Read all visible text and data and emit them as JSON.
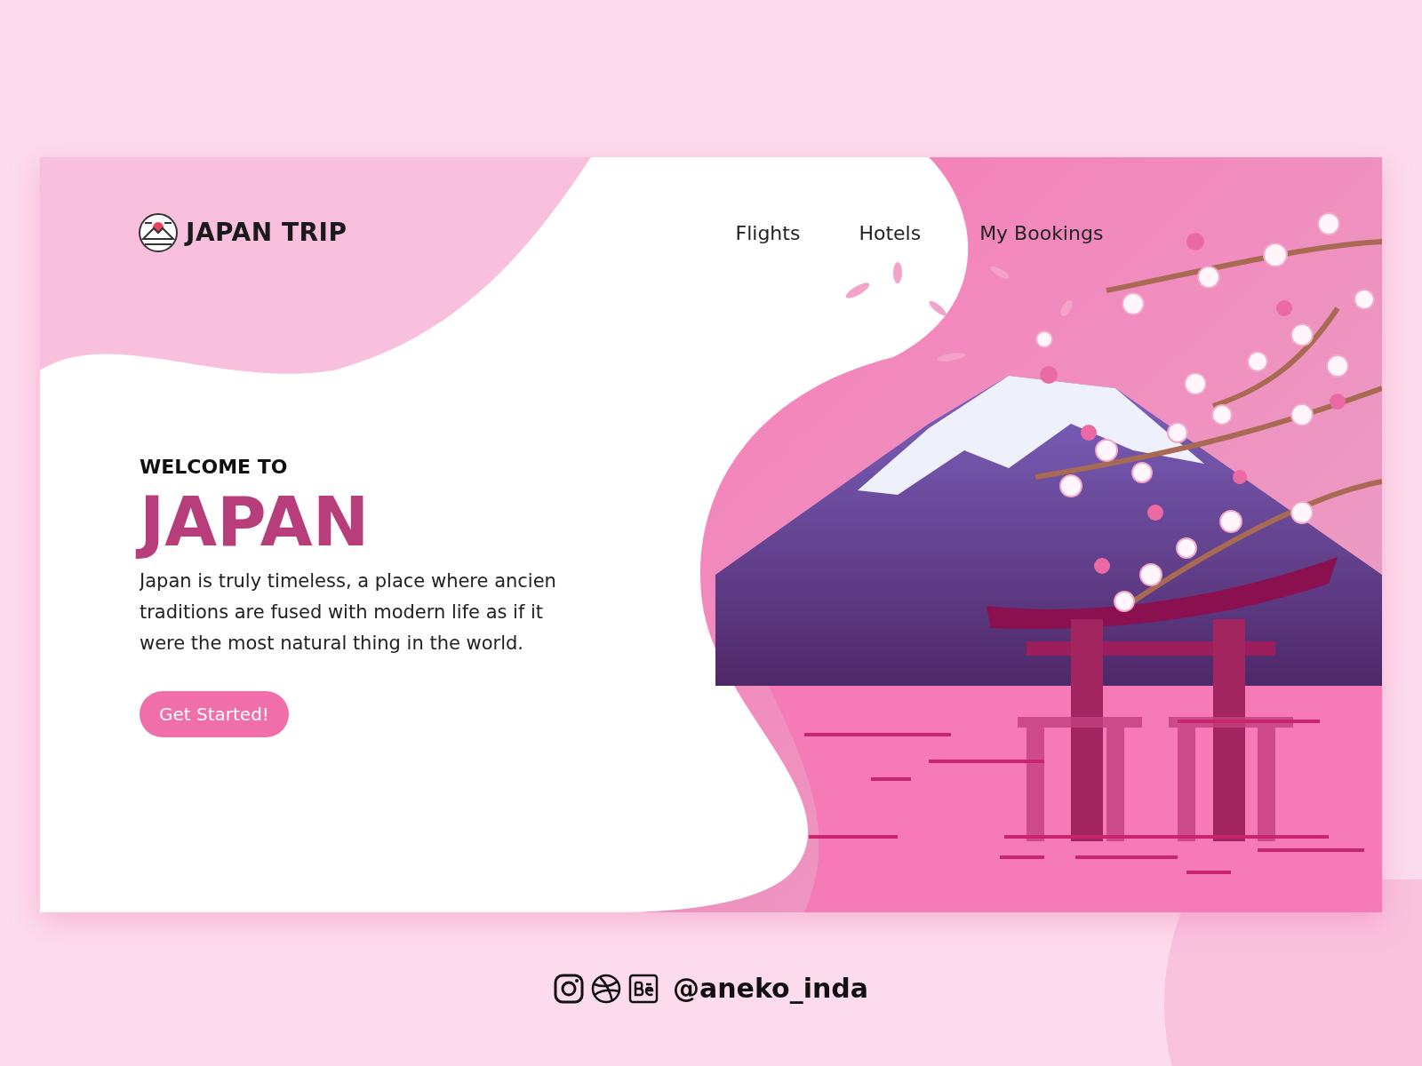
{
  "brand": {
    "name": "JAPAN TRIP"
  },
  "nav": [
    {
      "label": "Flights"
    },
    {
      "label": "Hotels"
    },
    {
      "label": "My Bookings"
    }
  ],
  "hero": {
    "eyebrow": "WELCOME TO",
    "title": "JAPAN",
    "lines": [
      "Japan is truly timeless, a place where ancien",
      "traditions are fused with modern life as if it",
      "were the most natural thing in the world."
    ],
    "button": "Get Started!"
  },
  "footer": {
    "handle": "@aneko_inda"
  }
}
